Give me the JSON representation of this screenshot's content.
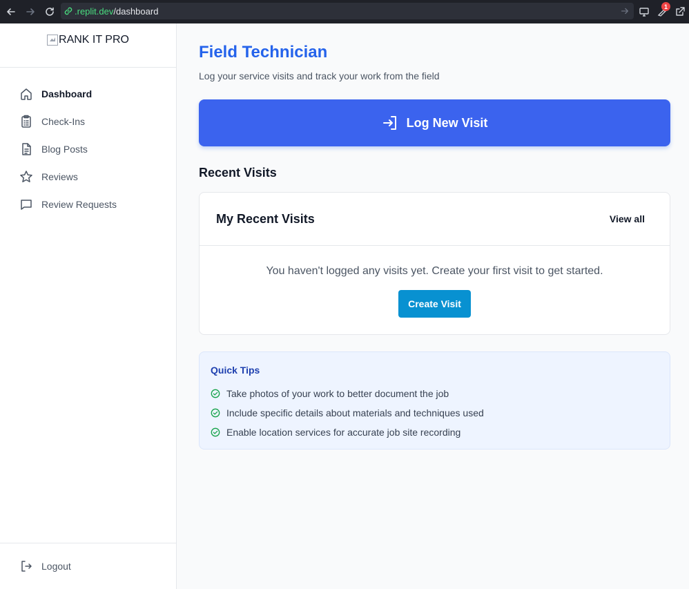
{
  "browser": {
    "url_host": ".replit.dev",
    "url_path": "/dashboard",
    "notification_count": "1"
  },
  "sidebar": {
    "logo_alt": "RANK IT PRO",
    "items": [
      {
        "label": "Dashboard",
        "icon": "home-icon",
        "active": true
      },
      {
        "label": "Check-Ins",
        "icon": "clipboard-icon",
        "active": false
      },
      {
        "label": "Blog Posts",
        "icon": "document-icon",
        "active": false
      },
      {
        "label": "Reviews",
        "icon": "star-icon",
        "active": false
      },
      {
        "label": "Review Requests",
        "icon": "message-icon",
        "active": false
      }
    ],
    "logout_label": "Logout"
  },
  "main": {
    "title": "Field Technician",
    "subtitle": "Log your service visits and track your work from the field",
    "log_button_label": "Log New Visit",
    "recent_section_title": "Recent Visits",
    "card": {
      "title": "My Recent Visits",
      "view_all_label": "View all",
      "empty_message": "You haven't logged any visits yet. Create your first visit to get started.",
      "create_button_label": "Create Visit"
    },
    "tips": {
      "title": "Quick Tips",
      "items": [
        "Take photos of your work to better document the job",
        "Include specific details about materials and techniques used",
        "Enable location services for accurate job site recording"
      ]
    }
  },
  "colors": {
    "primary": "#2563eb",
    "button_blue": "#3b63ee",
    "create_button": "#0891d1",
    "check_green": "#16a34a",
    "tips_bg": "#eef4ff"
  }
}
